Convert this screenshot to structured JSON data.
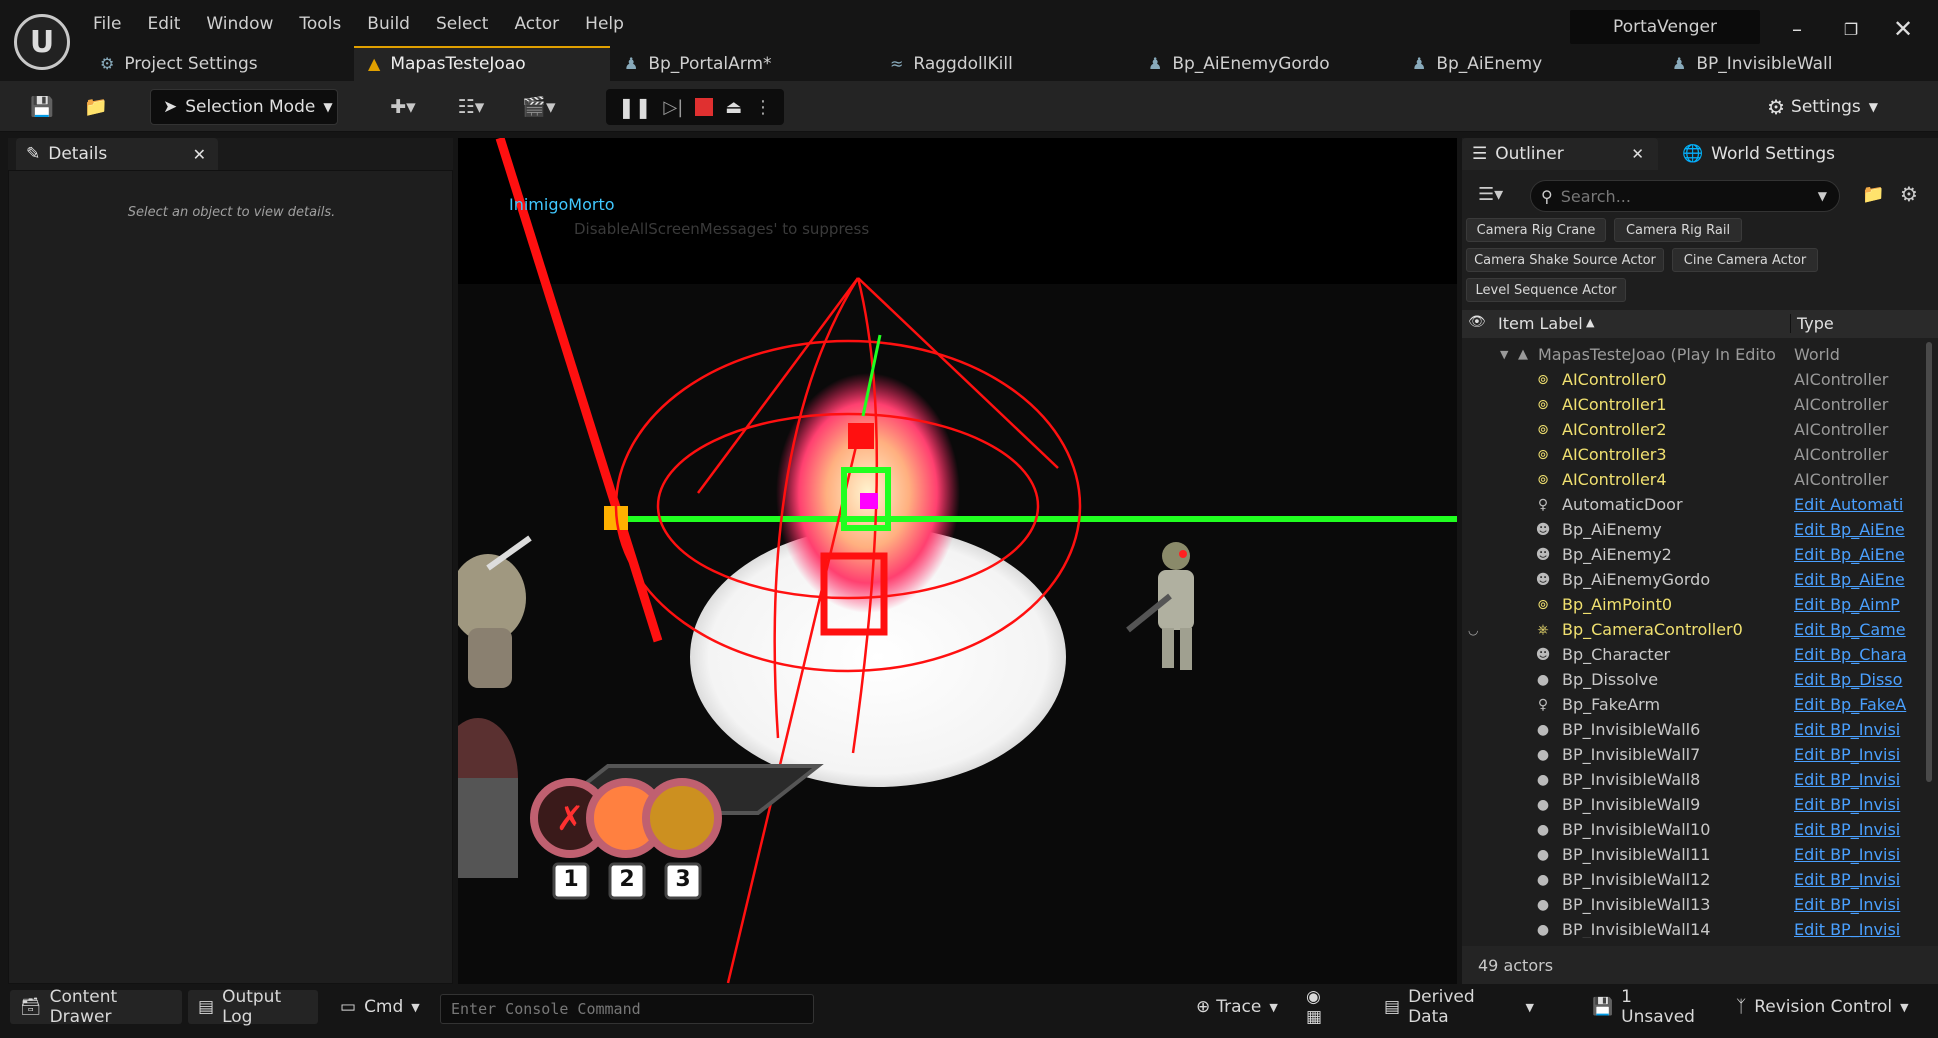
{
  "app": {
    "logo": "U",
    "project_name": "PortaVenger"
  },
  "menu": [
    "File",
    "Edit",
    "Window",
    "Tools",
    "Build",
    "Select",
    "Actor",
    "Help"
  ],
  "tabs": [
    {
      "label": "Project Settings",
      "icon": "gear-icon"
    },
    {
      "label": "MapasTesteJoao",
      "icon": "level-icon"
    },
    {
      "label": "Bp_PortalArm*",
      "icon": "pawn-icon"
    },
    {
      "label": "RaggdollKill",
      "icon": "anim-icon"
    },
    {
      "label": "Bp_AiEnemyGordo",
      "icon": "pawn-icon"
    },
    {
      "label": "Bp_AiEnemy",
      "icon": "pawn-icon"
    },
    {
      "label": "BP_InvisibleWall",
      "icon": "pawn-icon"
    }
  ],
  "toolbar": {
    "mode": "Selection Mode",
    "settings": "Settings"
  },
  "details": {
    "tab": "Details",
    "empty_message": "Select an object to view details."
  },
  "viewport": {
    "screen_message": "InimigoMorto",
    "hint": "DisableAllScreenMessages' to suppress",
    "slots": [
      "1",
      "2",
      "3"
    ]
  },
  "outliner": {
    "tab": "Outliner",
    "world_settings": "World Settings",
    "search_placeholder": "Search...",
    "chips": [
      "Camera Rig Crane",
      "Camera Rig Rail",
      "Camera Shake Source Actor",
      "Cine Camera Actor",
      "Level Sequence Actor"
    ],
    "col_label": "Item Label",
    "col_type": "Type",
    "root": {
      "label": "MapasTesteJoao (Play In Edito",
      "type": "World"
    },
    "rows": [
      {
        "label": "AIController0",
        "type": "AIController",
        "yellow": true,
        "link": false,
        "icon": "controller-icon"
      },
      {
        "label": "AIController1",
        "type": "AIController",
        "yellow": true,
        "link": false,
        "icon": "controller-icon"
      },
      {
        "label": "AIController2",
        "type": "AIController",
        "yellow": true,
        "link": false,
        "icon": "controller-icon"
      },
      {
        "label": "AIController3",
        "type": "AIController",
        "yellow": true,
        "link": false,
        "icon": "controller-icon"
      },
      {
        "label": "AIController4",
        "type": "AIController",
        "yellow": true,
        "link": false,
        "icon": "controller-icon"
      },
      {
        "label": "AutomaticDoor",
        "type": "Edit Automati",
        "yellow": false,
        "link": true,
        "icon": "actor-icon"
      },
      {
        "label": "Bp_AiEnemy",
        "type": "Edit Bp_AiEne",
        "yellow": false,
        "link": true,
        "icon": "pawn-icon"
      },
      {
        "label": "Bp_AiEnemy2",
        "type": "Edit Bp_AiEne",
        "yellow": false,
        "link": true,
        "icon": "pawn-icon"
      },
      {
        "label": "Bp_AiEnemyGordo",
        "type": "Edit Bp_AiEne",
        "yellow": false,
        "link": true,
        "icon": "pawn-icon"
      },
      {
        "label": "Bp_AimPoint0",
        "type": "Edit Bp_AimP",
        "yellow": true,
        "link": true,
        "icon": "controller-icon"
      },
      {
        "label": "Bp_CameraController0",
        "type": "Edit Bp_Came",
        "yellow": true,
        "link": true,
        "icon": "gamepad-icon"
      },
      {
        "label": "Bp_Character",
        "type": "Edit Bp_Chara",
        "yellow": false,
        "link": true,
        "icon": "pawn-icon"
      },
      {
        "label": "Bp_Dissolve",
        "type": "Edit Bp_Disso",
        "yellow": false,
        "link": true,
        "icon": "sphere-icon"
      },
      {
        "label": "Bp_FakeArm",
        "type": "Edit Bp_FakeA",
        "yellow": false,
        "link": true,
        "icon": "actor-icon"
      },
      {
        "label": "BP_InvisibleWall6",
        "type": "Edit BP_Invisi",
        "yellow": false,
        "link": true,
        "icon": "sphere-icon"
      },
      {
        "label": "BP_InvisibleWall7",
        "type": "Edit BP_Invisi",
        "yellow": false,
        "link": true,
        "icon": "sphere-icon"
      },
      {
        "label": "BP_InvisibleWall8",
        "type": "Edit BP_Invisi",
        "yellow": false,
        "link": true,
        "icon": "sphere-icon"
      },
      {
        "label": "BP_InvisibleWall9",
        "type": "Edit BP_Invisi",
        "yellow": false,
        "link": true,
        "icon": "sphere-icon"
      },
      {
        "label": "BP_InvisibleWall10",
        "type": "Edit BP_Invisi",
        "yellow": false,
        "link": true,
        "icon": "sphere-icon"
      },
      {
        "label": "BP_InvisibleWall11",
        "type": "Edit BP_Invisi",
        "yellow": false,
        "link": true,
        "icon": "sphere-icon"
      },
      {
        "label": "BP_InvisibleWall12",
        "type": "Edit BP_Invisi",
        "yellow": false,
        "link": true,
        "icon": "sphere-icon"
      },
      {
        "label": "BP_InvisibleWall13",
        "type": "Edit BP_Invisi",
        "yellow": false,
        "link": true,
        "icon": "sphere-icon"
      },
      {
        "label": "BP_InvisibleWall14",
        "type": "Edit BP_Invisi",
        "yellow": false,
        "link": true,
        "icon": "sphere-icon"
      }
    ],
    "footer": "49 actors"
  },
  "statusbar": {
    "content_drawer": "Content Drawer",
    "output_log": "Output Log",
    "cmd": "Cmd",
    "console_placeholder": "Enter Console Command",
    "trace": "Trace",
    "derived_data": "Derived Data",
    "unsaved": "1 Unsaved",
    "revision_control": "Revision Control"
  },
  "colors": {
    "accent": "#e0a000",
    "link": "#4aa0ff",
    "yellow_label": "#f0e070",
    "stop": "#e03030",
    "debug_red": "#ff1010",
    "debug_green": "#20ff20"
  }
}
